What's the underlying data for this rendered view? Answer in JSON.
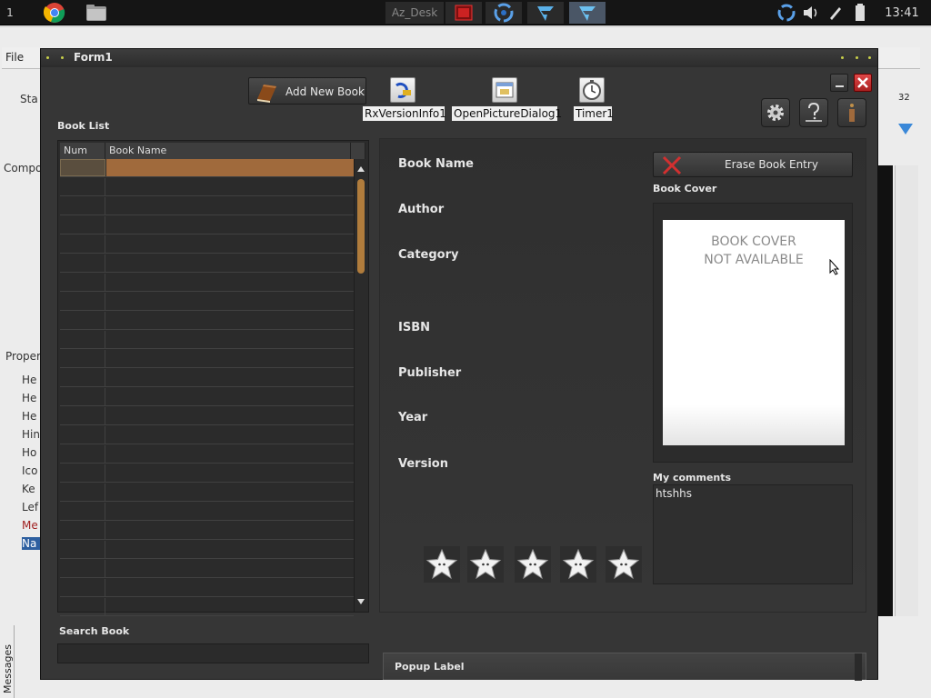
{
  "taskbar": {
    "workspace": "1",
    "desk_label": "Az_Desk",
    "clock": "13:41"
  },
  "ide": {
    "file_menu": "File",
    "side_labels": [
      "Sta",
      "Compo",
      "Proper"
    ],
    "prop_labels": [
      "He",
      "He",
      "He",
      "Hin",
      "Ho",
      "Ico",
      "Ke",
      "Lef",
      "Me",
      "Na"
    ],
    "messages_tab": "Messages",
    "side_number": "32"
  },
  "form": {
    "title": "Form1",
    "add_book_label": "Add New Book",
    "components": {
      "rxversion": "RxVersionInfo1",
      "opendialog": "OpenPictureDialog1",
      "timer": "Timer1"
    },
    "book_list_label": "Book List",
    "grid": {
      "columns": [
        "Num",
        "Book Name"
      ],
      "row_count": 24,
      "selected_row": 0
    },
    "fields": {
      "book_name": "Book Name",
      "author": "Author",
      "category": "Category",
      "isbn": "ISBN",
      "publisher": "Publisher",
      "year": "Year",
      "version": "Version"
    },
    "erase_label": "Erase Book Entry",
    "book_cover_label": "Book Cover",
    "cover_placeholder_line1": "BOOK COVER",
    "cover_placeholder_line2": "NOT AVAILABLE",
    "comments_label": "My comments",
    "comments_text": "htshhs",
    "rating": {
      "max": 5
    },
    "search_label": "Search Book",
    "search_value": "",
    "popup_label": "Popup Label"
  },
  "colors": {
    "form_bg": "#363636",
    "accent_orange": "#a06a3c",
    "title_dots": "#c8d04a",
    "close_red": "#c03030"
  }
}
